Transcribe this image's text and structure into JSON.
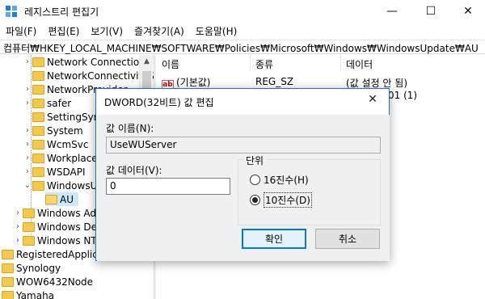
{
  "window": {
    "title": "레지스트리 편집기",
    "icon": "registry-editor-icon",
    "controls": {
      "minimize": "—",
      "maximize": "☐",
      "close": "✕"
    }
  },
  "menu": [
    "파일(F)",
    "편집(E)",
    "보기(V)",
    "즐겨찾기(A)",
    "도움말(H)"
  ],
  "address": "컴퓨터₩HKEY_LOCAL_MACHINE₩SOFTWARE₩Policies₩Microsoft₩Windows₩WindowsUpdate₩AU",
  "tree": {
    "items": [
      "Network Connections",
      "NetworkConnectivityS",
      "NetworkProvider",
      "safer",
      "SettingSync",
      "System",
      "WcmSvc",
      "WorkplaceJ",
      "WSDAPI",
      "WindowsUp",
      "AU",
      "Windows Adv",
      "Windows Defe",
      "Windows NT",
      "RegisteredApplication",
      "Synology",
      "WOW6432Node",
      "Yamaha"
    ]
  },
  "list": {
    "headers": [
      "이름",
      "종류",
      "데이터"
    ],
    "rows": [
      {
        "name": "(기본값)",
        "type": "REG_SZ",
        "data": "(값 설정 안 됨)"
      },
      {
        "name": "",
        "type": "",
        "data": "01 (1)"
      }
    ]
  },
  "dialog": {
    "title": "DWORD(32비트) 값 편집",
    "close": "✕",
    "value_name_label": "값 이름(N):",
    "value_name": "UseWUServer",
    "value_data_label": "값 데이터(V):",
    "value_data": "0",
    "base_label": "단위",
    "hex_label": "16진수(H)",
    "dec_label": "10진수(D)",
    "selected_base": "10진수(D)",
    "ok_label": "확인",
    "cancel_label": "취소"
  }
}
